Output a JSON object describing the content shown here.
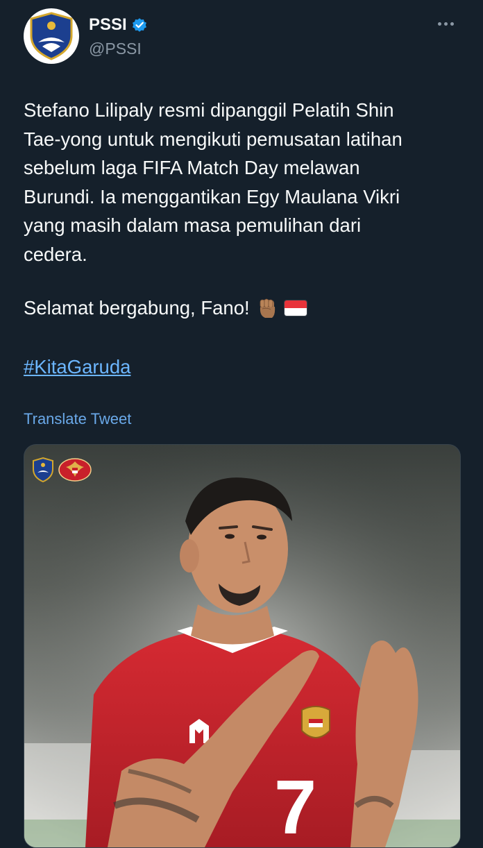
{
  "header": {
    "display_name": "PSSI",
    "handle": "@PSSI",
    "verified": true,
    "avatar_icon": "pssi-logo-icon",
    "more_icon": "more-options-icon"
  },
  "tweet": {
    "lines": [
      "Stefano Lilipaly resmi dipanggil Pelatih Shin",
      "Tae-yong untuk mengikuti pemusatan latihan",
      "sebelum laga FIFA Match Day melawan",
      "Burundi. Ia menggantikan Egy Maulana Vikri",
      "yang masih dalam masa pemulihan dari",
      "cedera."
    ],
    "greeting": "Selamat bergabung, Fano!",
    "greeting_emojis": [
      "raised-fist-emoji",
      "indonesia-flag-emoji"
    ],
    "hashtag": "#KitaGaruda",
    "translate_label": "Translate Tweet"
  },
  "media": {
    "type": "photo",
    "badges": [
      "pssi-badge-icon",
      "garuda-badge-icon"
    ],
    "jersey_number": "7"
  },
  "colors": {
    "background": "#15202b",
    "text": "#f7f9f9",
    "secondary_text": "#8b98a5",
    "link": "#6aa9e9",
    "verified": "#1d9bf0",
    "jersey_red": "#c8202a"
  }
}
